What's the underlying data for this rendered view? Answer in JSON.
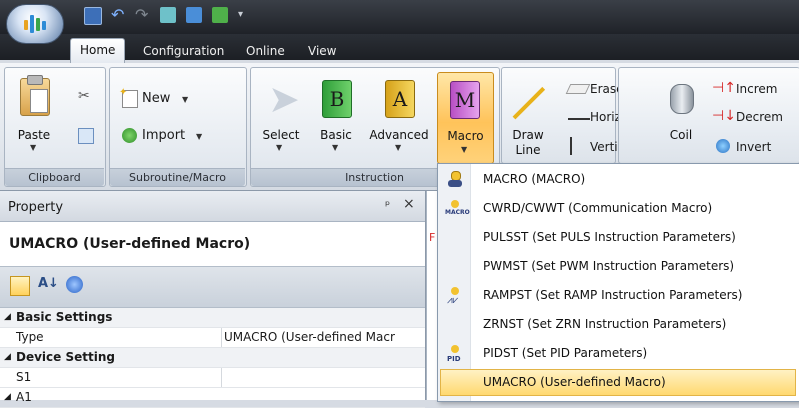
{
  "ribbon": {
    "tabs": [
      {
        "label": "Home"
      },
      {
        "label": "Configuration"
      },
      {
        "label": "Online"
      },
      {
        "label": "View"
      }
    ],
    "groups": {
      "clipboard": {
        "label": "Clipboard",
        "paste": "Paste"
      },
      "subroutine": {
        "label": "Subroutine/Macro",
        "new": "New",
        "import": "Import"
      },
      "instruction": {
        "label": "Instruction",
        "select": "Select",
        "basic": "Basic",
        "advanced": "Advanced",
        "macro": "Macro"
      },
      "draw": {
        "draw_line_1": "Draw",
        "draw_line_2": "Line",
        "eraser": "Eraser",
        "horizontal": "Horizontal",
        "vertical": "Vertical"
      },
      "coil": {
        "coil": "Coil",
        "increment": "Increm",
        "decrement": "Decrem",
        "invert": "Invert"
      }
    },
    "icon_letters": {
      "basic": "B",
      "advanced": "A",
      "macro": "M"
    }
  },
  "property_panel": {
    "title": "Property",
    "pin": "ᵖ",
    "close": "×",
    "selected_object": "UMACRO (User-defined Macro)",
    "rows": [
      {
        "kind": "category",
        "name": "Basic Settings"
      },
      {
        "kind": "item",
        "name": "Type",
        "value": "UMACRO (User-defined Macr"
      },
      {
        "kind": "category",
        "name": "Device Setting"
      },
      {
        "kind": "item",
        "name": "S1",
        "value": ""
      },
      {
        "kind": "category",
        "name": "A1",
        "value": ""
      }
    ]
  },
  "macro_menu": {
    "items": [
      {
        "label": "MACRO (MACRO)",
        "icon": "macro-icon",
        "highlighted": false
      },
      {
        "label": "CWRD/CWWT (Communication Macro)",
        "icon": "comm-macro-icon",
        "highlighted": false
      },
      {
        "label": "PULSST (Set PULS Instruction Parameters)",
        "icon": "",
        "highlighted": false
      },
      {
        "label": "PWMST (Set PWM Instruction Parameters)",
        "icon": "",
        "highlighted": false
      },
      {
        "label": "RAMPST (Set RAMP Instruction Parameters)",
        "icon": "ramp-icon",
        "highlighted": false
      },
      {
        "label": "ZRNST (Set ZRN Instruction Parameters)",
        "icon": "",
        "highlighted": false
      },
      {
        "label": "PIDST (Set PID Parameters)",
        "icon": "pid-icon",
        "highlighted": false
      },
      {
        "label": "UMACRO (User-defined Macro)",
        "icon": "",
        "highlighted": true
      }
    ],
    "icon_texts": {
      "comm": "MACRO",
      "pid": "PID"
    }
  },
  "colors": {
    "highlight": "#ffd970",
    "ribbon_bg": "#e3e8ee",
    "macro_button_active": "#ffc35a"
  }
}
